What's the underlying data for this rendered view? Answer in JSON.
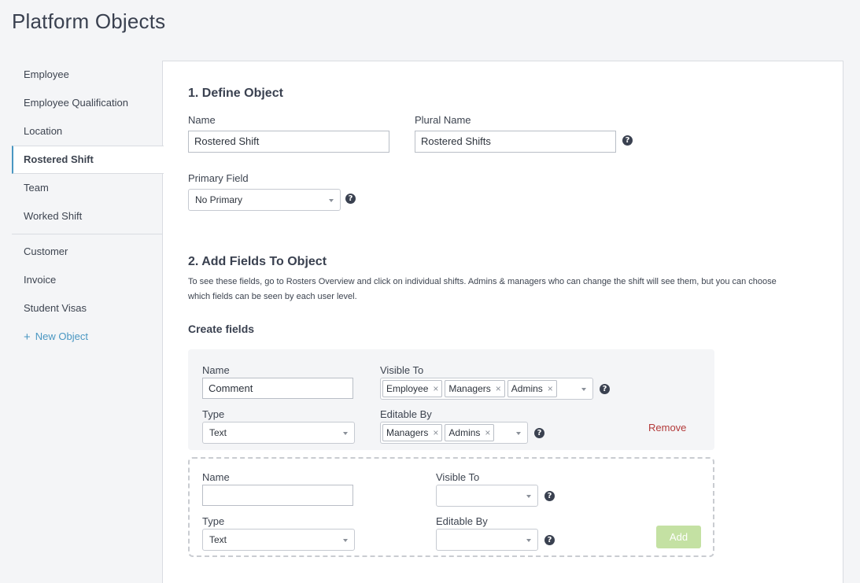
{
  "page_title": "Platform Objects",
  "sidebar": {
    "group1": [
      "Employee",
      "Employee Qualification",
      "Location",
      "Rostered Shift",
      "Team",
      "Worked Shift"
    ],
    "group2": [
      "Customer",
      "Invoice",
      "Student Visas"
    ],
    "new_object": "New Object",
    "active": "Rostered Shift"
  },
  "define": {
    "heading": "1. Define Object",
    "name_label": "Name",
    "name_value": "Rostered Shift",
    "plural_label": "Plural Name",
    "plural_value": "Rostered Shifts",
    "primary_label": "Primary Field",
    "primary_value": "No Primary"
  },
  "fields": {
    "heading": "2. Add Fields To Object",
    "description_line1": "To see these fields, go to Rosters Overview and click on individual shifts. Admins & managers who can change the shift will see them, but you can choose",
    "description_line2": "which fields can be seen by each user level.",
    "create_heading": "Create fields",
    "existing": {
      "name_label": "Name",
      "name_value": "Comment",
      "type_label": "Type",
      "type_value": "Text",
      "visible_label": "Visible To",
      "visible_tags": [
        "Employee",
        "Managers",
        "Admins"
      ],
      "editable_label": "Editable By",
      "editable_tags": [
        "Managers",
        "Admins"
      ],
      "remove_label": "Remove"
    },
    "new": {
      "name_label": "Name",
      "name_value": "",
      "type_label": "Type",
      "type_value": "Text",
      "visible_label": "Visible To",
      "editable_label": "Editable By",
      "add_label": "Add"
    }
  },
  "icons": {
    "help": "?",
    "remove_tag": "×",
    "plus": "+"
  },
  "colors": {
    "accent": "#4a97c2",
    "remove": "#b33a3a",
    "add_button": "#c4e1a3"
  }
}
